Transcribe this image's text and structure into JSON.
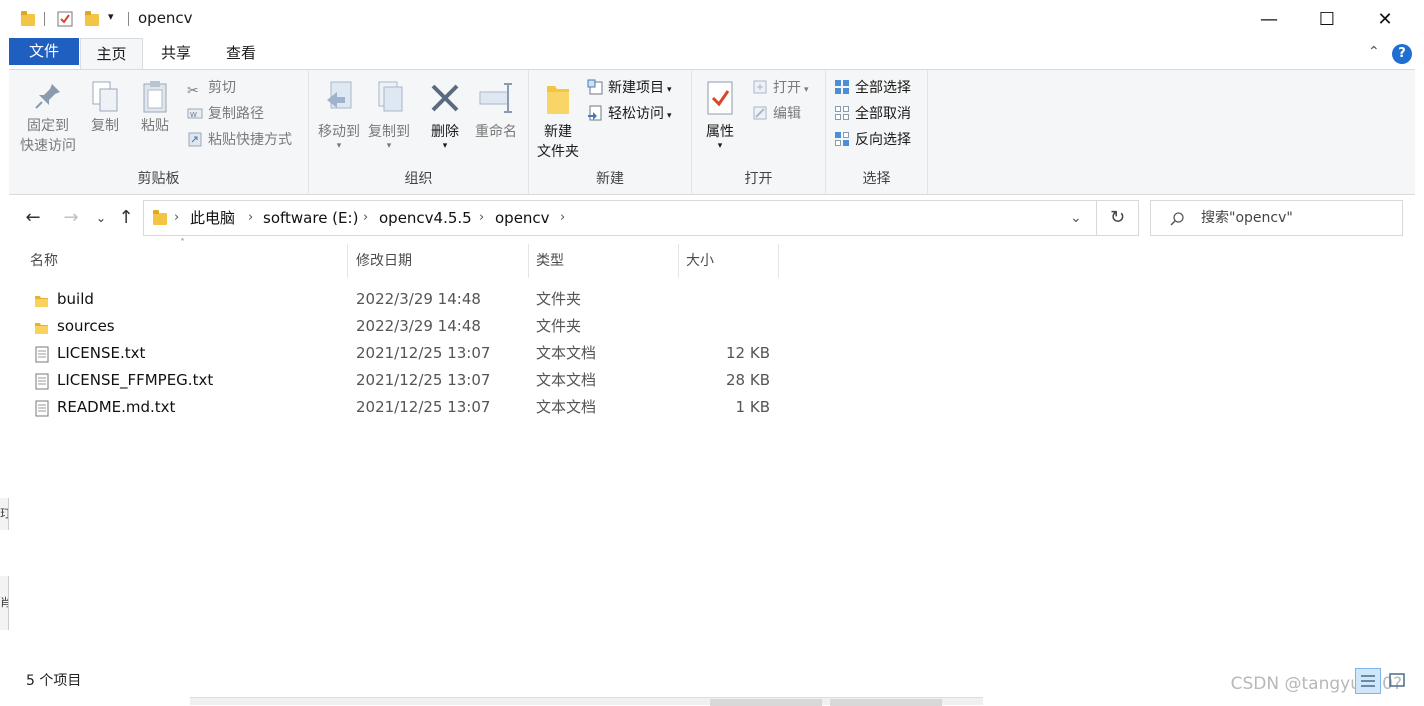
{
  "window": {
    "title": "opencv",
    "minimize": "—",
    "maximize": "☐",
    "close": "✕"
  },
  "tabs": [
    {
      "label": "文件"
    },
    {
      "label": "主页"
    },
    {
      "label": "共享"
    },
    {
      "label": "查看"
    }
  ],
  "ribbon": {
    "clipboard": {
      "pin_line1": "固定到",
      "pin_line2": "快速访问",
      "copy": "复制",
      "paste": "粘贴",
      "cut": "剪切",
      "copy_path": "复制路径",
      "paste_shortcut": "粘贴快捷方式",
      "label": "剪贴板"
    },
    "organize": {
      "move_to": "移动到",
      "copy_to": "复制到",
      "delete": "删除",
      "rename": "重命名",
      "label": "组织"
    },
    "new": {
      "new_folder_line1": "新建",
      "new_folder_line2": "文件夹",
      "new_item": "新建项目",
      "easy_access": "轻松访问",
      "label": "新建"
    },
    "open": {
      "properties": "属性",
      "open": "打开",
      "edit": "编辑",
      "label": "打开"
    },
    "select": {
      "select_all": "全部选择",
      "select_none": "全部取消",
      "invert": "反向选择",
      "label": "选择"
    }
  },
  "address": {
    "crumbs": [
      "此电脑",
      "software (E:)",
      "opencv4.5.5",
      "opencv"
    ]
  },
  "search": {
    "placeholder": "搜索\"opencv\""
  },
  "columns": {
    "name": "名称",
    "date": "修改日期",
    "type": "类型",
    "size": "大小"
  },
  "files": [
    {
      "name": "build",
      "date": "2022/3/29 14:48",
      "type": "文件夹",
      "size": "",
      "kind": "folder"
    },
    {
      "name": "sources",
      "date": "2022/3/29 14:48",
      "type": "文件夹",
      "size": "",
      "kind": "folder"
    },
    {
      "name": "LICENSE.txt",
      "date": "2021/12/25 13:07",
      "type": "文本文档",
      "size": "12 KB",
      "kind": "text"
    },
    {
      "name": "LICENSE_FFMPEG.txt",
      "date": "2021/12/25 13:07",
      "type": "文本文档",
      "size": "28 KB",
      "kind": "text"
    },
    {
      "name": "README.md.txt",
      "date": "2021/12/25 13:07",
      "type": "文本文档",
      "size": "1 KB",
      "kind": "text"
    }
  ],
  "status": {
    "count": "5 个项目"
  },
  "watermark": "CSDN @tangyubo0?",
  "edge_clips": {
    "a": "玎",
    "b": "肖"
  },
  "colors": {
    "file_tab": "#1f5fbf",
    "ribbon_bg": "#f5f6f7",
    "folder": "#f4c542",
    "help": "#1f6fd1"
  }
}
